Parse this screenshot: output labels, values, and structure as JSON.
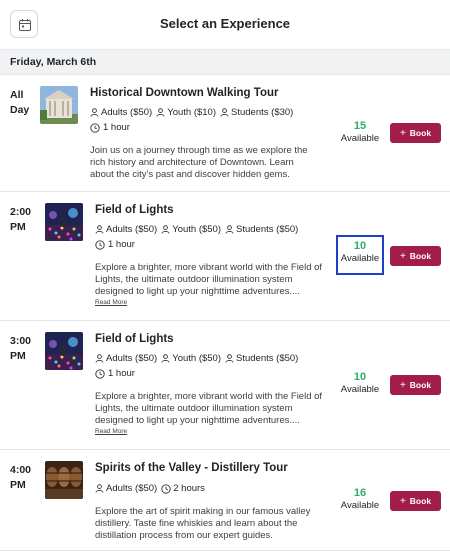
{
  "header": {
    "title": "Select an Experience",
    "calendar_icon": "calendar-icon"
  },
  "date_label": "Friday, March 6th",
  "colors": {
    "accent": "#a31d49",
    "available": "#2fae6a",
    "highlight": "#1f3ec9"
  },
  "tours": [
    {
      "time_line1": "All",
      "time_line2": "Day",
      "title": "Historical Downtown Walking Tour",
      "prices": [
        "Adults ($50)",
        "Youth ($10)",
        "Students ($30)"
      ],
      "duration": "1 hour",
      "description": "Join us on a journey through time as we explore the rich history and architecture of Downtown. Learn about the city's past and discover hidden gems.",
      "available_count": "15",
      "available_label": "Available",
      "book_label": "Book"
    },
    {
      "time_line1": "2:00",
      "time_line2": "PM",
      "title": "Field of Lights",
      "prices": [
        "Adults ($50)",
        "Youth ($50)",
        "Students ($50)"
      ],
      "duration": "1 hour",
      "description": "Explore a brighter, more vibrant world with the Field of Lights, the ultimate outdoor illumination system designed to light up your nighttime adventures....",
      "read_more": "Read More",
      "available_count": "10",
      "available_label": "Available",
      "book_label": "Book"
    },
    {
      "time_line1": "3:00",
      "time_line2": "PM",
      "title": "Field of Lights",
      "prices": [
        "Adults ($50)",
        "Youth ($50)",
        "Students ($50)"
      ],
      "duration": "1 hour",
      "description": "Explore a brighter, more vibrant world with the Field of Lights, the ultimate outdoor illumination system designed to light up your nighttime adventures....",
      "read_more": "Read More",
      "available_count": "10",
      "available_label": "Available",
      "book_label": "Book"
    },
    {
      "time_line1": "4:00",
      "time_line2": "PM",
      "title": "Spirits of the Valley - Distillery Tour",
      "prices": [
        "Adults ($50)"
      ],
      "duration": "2 hours",
      "description": "Explore the art of spirit making in our famous valley distillery. Taste fine whiskies and learn about the distillation process from our expert guides.",
      "available_count": "16",
      "available_label": "Available",
      "book_label": "Book"
    }
  ]
}
